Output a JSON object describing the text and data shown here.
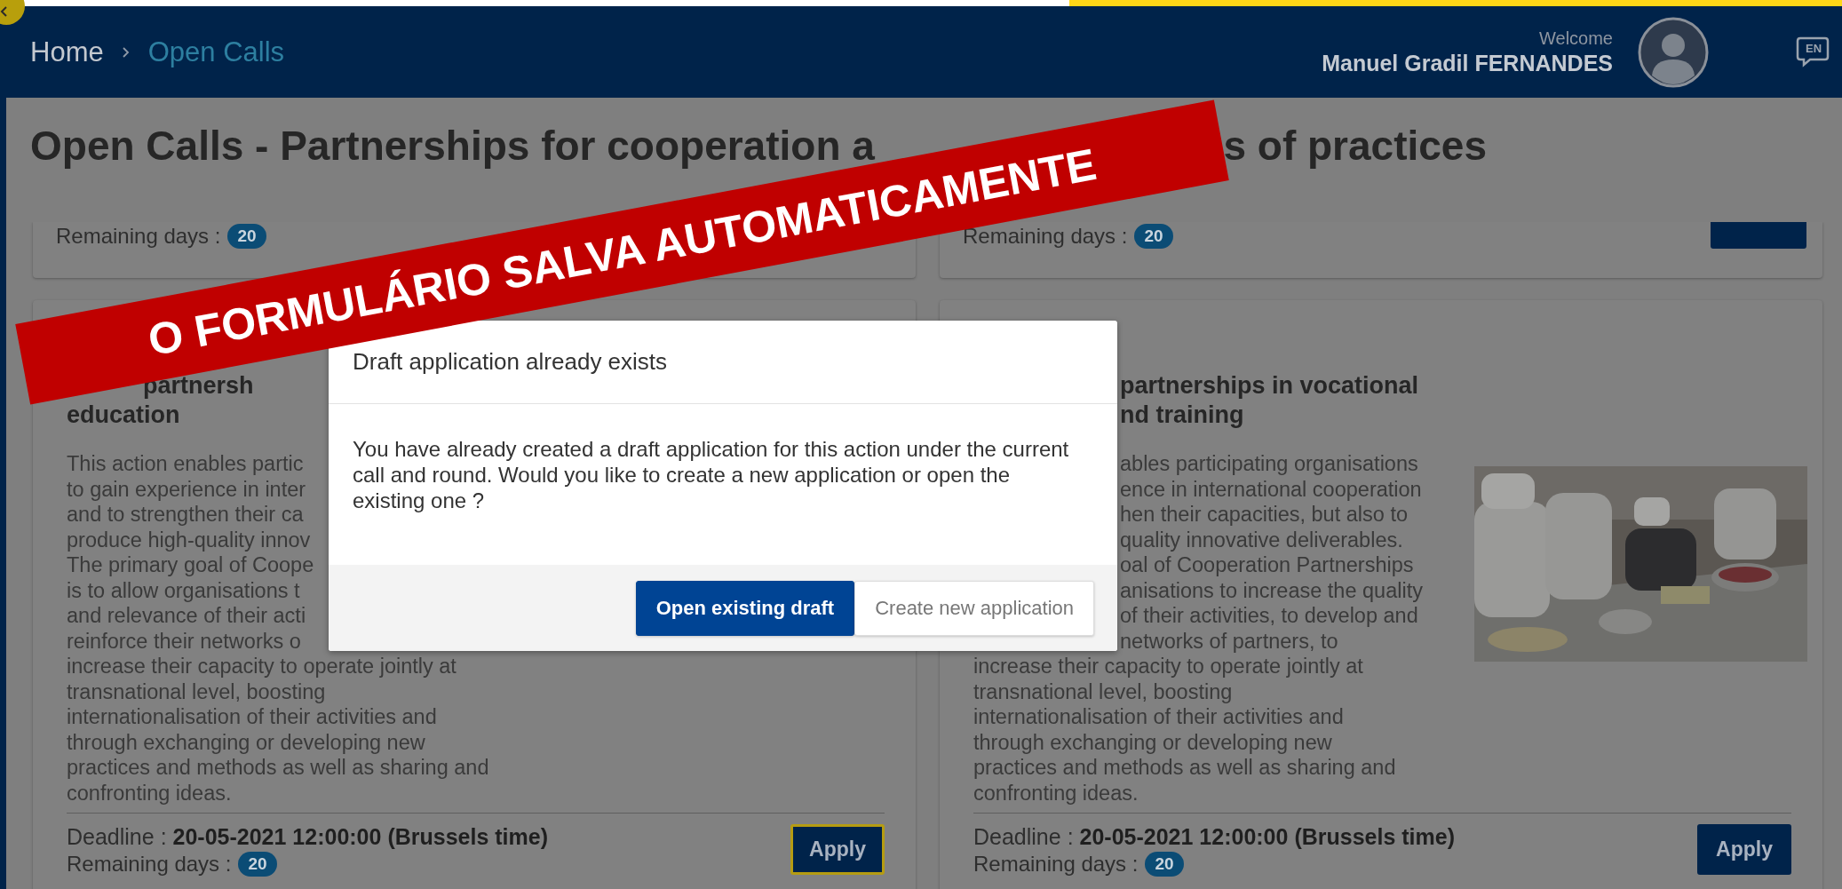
{
  "breadcrumb": [
    {
      "label": "Home",
      "current": false
    },
    {
      "label": "Open Calls",
      "current": true
    }
  ],
  "user": {
    "greeting": "Welcome",
    "name": "Manuel Gradil FERNANDES"
  },
  "language": "EN",
  "page_title_parts": [
    "Open Calls - Partnerships for cooperation a",
    "s of practices"
  ],
  "top_cards": [
    {
      "remaining_label": "Remaining days :",
      "remaining": "20",
      "has_apply": false
    },
    {
      "remaining_label": "Remaining days :",
      "remaining": "20",
      "has_apply": true
    }
  ],
  "cards": [
    {
      "title_lines": [
        {
          "text": "partnersh",
          "kind": "shifted"
        },
        {
          "text": "education",
          "kind": "line"
        }
      ],
      "description_lines": [
        {
          "text": "This action enables partic",
          "kind": "line"
        },
        {
          "text": "to gain experience in inter",
          "kind": "line"
        },
        {
          "text": "and to strengthen their ca",
          "kind": "line"
        },
        {
          "text": "produce high-quality innov",
          "kind": "line"
        },
        {
          "text": "The primary goal of Coope",
          "kind": "line"
        },
        {
          "text": "is to allow organisations t",
          "kind": "line"
        },
        {
          "text": "and relevance of their acti",
          "kind": "line"
        },
        {
          "text": "reinforce their networks o",
          "kind": "line"
        },
        {
          "text": "increase their capacity to operate jointly at",
          "kind": "line"
        },
        {
          "text": "transnational level, boosting",
          "kind": "line"
        },
        {
          "text": "internationalisation of their activities and",
          "kind": "line"
        },
        {
          "text": "through exchanging or developing new",
          "kind": "line"
        },
        {
          "text": "practices and methods as well as sharing and",
          "kind": "line"
        },
        {
          "text": "confronting ideas.",
          "kind": "line"
        }
      ],
      "deadline_label": "Deadline :",
      "deadline": "20-05-2021 12:00:00 (Brussels time)",
      "remaining_label": "Remaining days :",
      "remaining": "20",
      "apply": {
        "label": "Apply",
        "focused": true
      }
    },
    {
      "title_lines": [
        {
          "text": "partnerships in vocational",
          "kind": "tail"
        },
        {
          "text": "nd training",
          "kind": "tail"
        }
      ],
      "description_lines": [
        {
          "text": "ables participating organisations",
          "kind": "tail"
        },
        {
          "text": "ence in international cooperation",
          "kind": "tail"
        },
        {
          "text": "hen their capacities, but also to",
          "kind": "tail"
        },
        {
          "text": "quality innovative deliverables.",
          "kind": "tail"
        },
        {
          "text": "oal of Cooperation Partnerships",
          "kind": "tail"
        },
        {
          "text": "anisations to increase the quality",
          "kind": "tail"
        },
        {
          "text": "of their activities, to develop and",
          "kind": "tail"
        },
        {
          "text": "networks of partners, to",
          "kind": "tail"
        },
        {
          "text": "increase their capacity to operate jointly at",
          "kind": "line"
        },
        {
          "text": "transnational level, boosting",
          "kind": "line"
        },
        {
          "text": "internationalisation of their activities and",
          "kind": "line"
        },
        {
          "text": "through exchanging or developing new",
          "kind": "line"
        },
        {
          "text": "practices and methods as well as sharing and",
          "kind": "line"
        },
        {
          "text": "confronting ideas.",
          "kind": "line"
        }
      ],
      "deadline_label": "Deadline :",
      "deadline": "20-05-2021 12:00:00 (Brussels time)",
      "remaining_label": "Remaining days :",
      "remaining": "20",
      "apply": {
        "label": "Apply",
        "focused": false
      }
    }
  ],
  "dialog": {
    "title": "Draft application already exists",
    "message": "You have already created a draft application for this action under the current call and round. Would you like to create a new application or open the existing one ?",
    "buttons": [
      {
        "label": "Open existing draft",
        "primary": true
      },
      {
        "label": "Create new application",
        "primary": false
      }
    ]
  },
  "banner": {
    "text": "O FORMULÁRIO SALVA AUTOMATICAMENTE"
  }
}
